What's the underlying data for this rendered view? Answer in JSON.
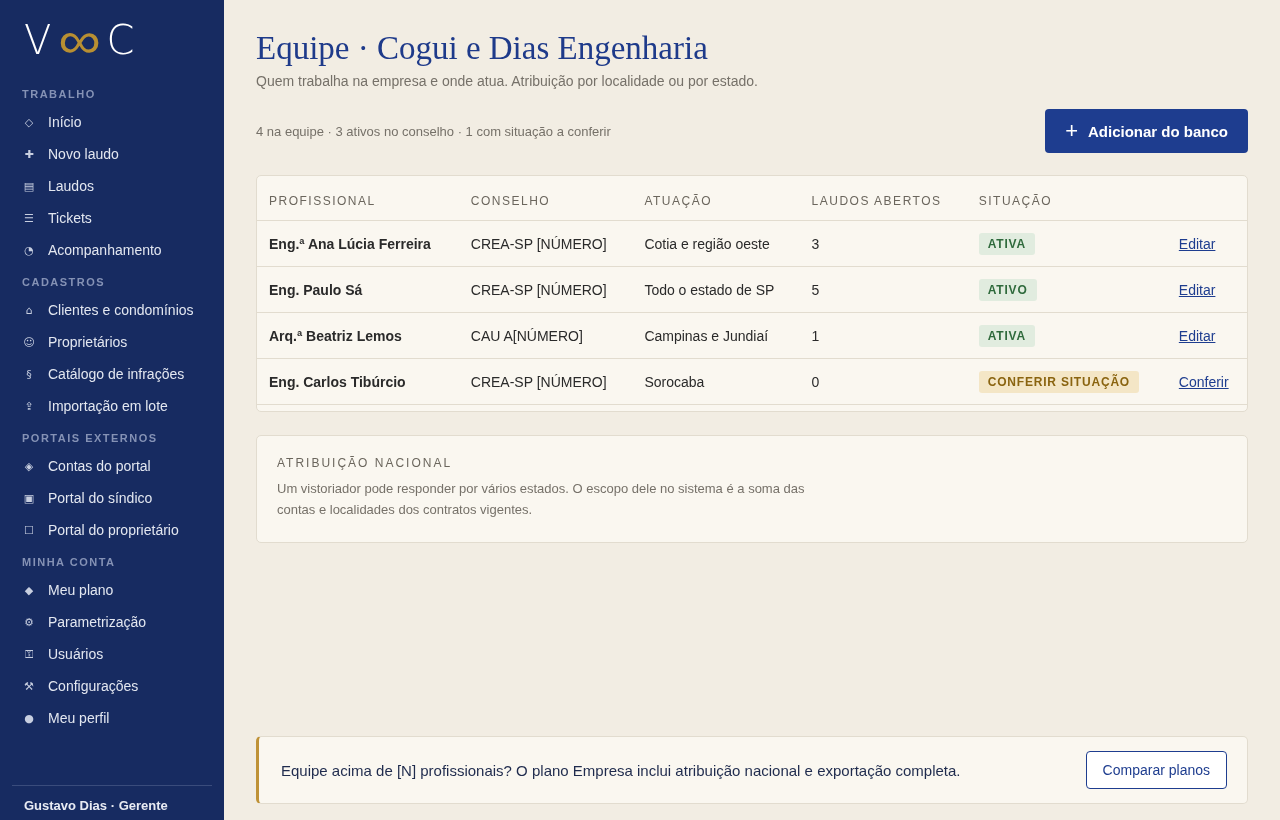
{
  "sidebar": {
    "logo": [
      "V",
      "∞",
      "C"
    ],
    "sections": [
      {
        "title": "TRABALHO",
        "items": [
          {
            "icon": "◇",
            "label": "Início"
          },
          {
            "icon": "✚",
            "label": "Novo laudo"
          },
          {
            "icon": "▤",
            "label": "Laudos"
          },
          {
            "icon": "☰",
            "label": "Tickets"
          },
          {
            "icon": "◔",
            "label": "Acompanhamento"
          }
        ]
      },
      {
        "title": "CADASTROS",
        "items": [
          {
            "icon": "⌂",
            "label": "Clientes e condomínios"
          },
          {
            "icon": "☺",
            "label": "Proprietários"
          },
          {
            "icon": "§",
            "label": "Catálogo de infrações"
          },
          {
            "icon": "⇪",
            "label": "Importação em lote"
          }
        ]
      },
      {
        "title": "PORTAIS EXTERNOS",
        "items": [
          {
            "icon": "◈",
            "label": "Contas do portal"
          },
          {
            "icon": "▣",
            "label": "Portal do síndico"
          },
          {
            "icon": "☐",
            "label": "Portal do proprietário"
          }
        ]
      },
      {
        "title": "MINHA CONTA",
        "items": [
          {
            "icon": "◆",
            "label": "Meu plano"
          },
          {
            "icon": "⚙",
            "label": "Parametrização"
          },
          {
            "icon": "⚿",
            "label": "Usuários"
          },
          {
            "icon": "⚒",
            "label": "Configurações"
          },
          {
            "icon": "●",
            "label": "Meu perfil"
          }
        ]
      }
    ],
    "user": "Gustavo Dias · Gerente"
  },
  "page": {
    "title": "Equipe · Cogui e Dias Engenharia",
    "subtitle": "Quem trabalha na empresa e onde atua. Atribuição por localidade ou por estado.",
    "summary": "4 na equipe · 3 ativos no conselho · 1 com situação a conferir",
    "add_button": {
      "icon": "+",
      "label": "Adicionar do banco"
    }
  },
  "table": {
    "columns": [
      "PROFISSIONAL",
      "CONSELHO",
      "ATUAÇÃO",
      "LAUDOS ABERTOS",
      "SITUAÇÃO"
    ],
    "rows": [
      {
        "name": "Eng.ª Ana Lúcia Ferreira",
        "council": "CREA-SP [NÚMERO]",
        "area": "Cotia e região oeste",
        "open": "3",
        "status": {
          "kind": "ok",
          "label": "ATIVA"
        },
        "action": "Editar"
      },
      {
        "name": "Eng. Paulo Sá",
        "council": "CREA-SP [NÚMERO]",
        "area": "Todo o estado de SP",
        "open": "5",
        "status": {
          "kind": "ok",
          "label": "ATIVO"
        },
        "action": "Editar"
      },
      {
        "name": "Arq.ª Beatriz Lemos",
        "council": "CAU A[NÚMERO]",
        "area": "Campinas e Jundiaí",
        "open": "1",
        "status": {
          "kind": "ok",
          "label": "ATIVA"
        },
        "action": "Editar"
      },
      {
        "name": "Eng. Carlos Tibúrcio",
        "council": "CREA-SP [NÚMERO]",
        "area": "Sorocaba",
        "open": "0",
        "status": {
          "kind": "warn",
          "label": "CONFERIR SITUAÇÃO"
        },
        "action": "Conferir"
      }
    ]
  },
  "info": {
    "title": "ATRIBUIÇÃO NACIONAL",
    "text": "Um vistoriador pode responder por vários estados. O escopo dele no sistema é a soma das contas e localidades dos contratos vigentes."
  },
  "banner": {
    "text": "Equipe acima de [N] profissionais? O plano Empresa inclui atribuição nacional e exportação completa.",
    "button": "Comparar planos"
  }
}
